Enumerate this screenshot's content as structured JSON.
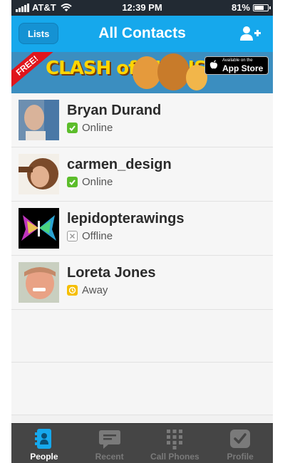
{
  "status_bar": {
    "carrier": "AT&T",
    "time": "12:39 PM",
    "battery": "81%",
    "battery_level": 0.81
  },
  "nav": {
    "left_button": "Lists",
    "title": "All Contacts",
    "right_icon": "add-contact-icon"
  },
  "ad": {
    "ribbon": "FREE!",
    "title": "CLASH of CLANS",
    "store_small": "Available on the",
    "store_big": "App Store"
  },
  "contacts": [
    {
      "name": "Bryan Durand",
      "status": "Online",
      "status_type": "online"
    },
    {
      "name": "carmen_design",
      "status": "Online",
      "status_type": "online"
    },
    {
      "name": "lepidopterawings",
      "status": "Offline",
      "status_type": "offline"
    },
    {
      "name": "Loreta Jones",
      "status": "Away",
      "status_type": "away"
    }
  ],
  "tabs": [
    {
      "label": "People",
      "icon": "people-icon",
      "active": true
    },
    {
      "label": "Recent",
      "icon": "chat-bubble-icon",
      "active": false
    },
    {
      "label": "Call Phones",
      "icon": "keypad-icon",
      "active": false
    },
    {
      "label": "Profile",
      "icon": "profile-check-icon",
      "active": false
    }
  ],
  "colors": {
    "accent": "#16a8ec",
    "online": "#5cbd2b",
    "away": "#f5be00",
    "tabbar": "#454545"
  }
}
